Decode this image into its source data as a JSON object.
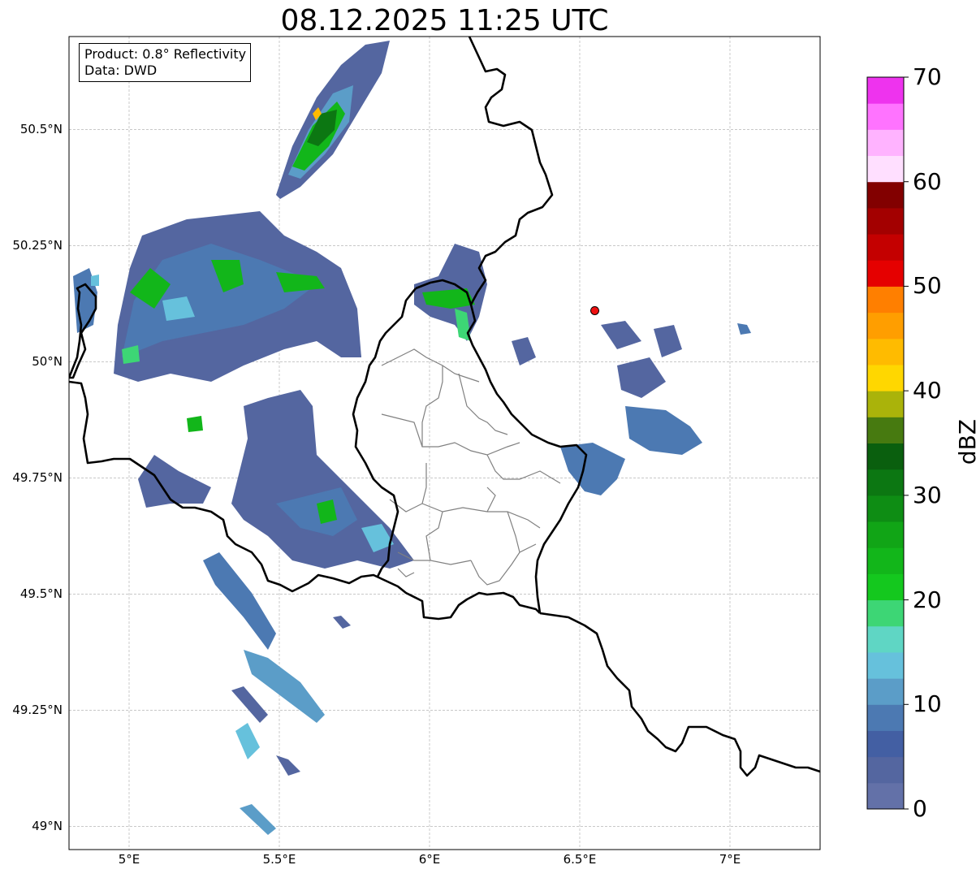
{
  "title": "08.12.2025 11:25 UTC",
  "info_box": {
    "product": "Product: 0.8° Reflectivity",
    "source": "Data: DWD"
  },
  "map": {
    "lon_range": [
      4.8,
      7.3
    ],
    "lat_range": [
      48.95,
      50.7
    ],
    "x_ticks": [
      {
        "lon": 5.0,
        "label": "5°E"
      },
      {
        "lon": 5.5,
        "label": "5.5°E"
      },
      {
        "lon": 6.0,
        "label": "6°E"
      },
      {
        "lon": 6.5,
        "label": "6.5°E"
      },
      {
        "lon": 7.0,
        "label": "7°E"
      }
    ],
    "y_ticks": [
      {
        "lat": 50.5,
        "label": "50.5°N"
      },
      {
        "lat": 50.25,
        "label": "50.25°N"
      },
      {
        "lat": 50.0,
        "label": "50°N"
      },
      {
        "lat": 49.75,
        "label": "49.75°N"
      },
      {
        "lat": 49.5,
        "label": "49.5°N"
      },
      {
        "lat": 49.25,
        "label": "49.25°N"
      },
      {
        "lat": 49.0,
        "label": "49°N"
      }
    ],
    "gridlines": true,
    "radar_site": {
      "lon": 6.55,
      "lat": 50.11,
      "color": "#ee1111"
    }
  },
  "colorbar": {
    "label": "dBZ",
    "range": [
      0,
      70
    ],
    "ticks": [
      {
        "value": 0,
        "label": "0"
      },
      {
        "value": 10,
        "label": "10"
      },
      {
        "value": 20,
        "label": "20"
      },
      {
        "value": 30,
        "label": "30"
      },
      {
        "value": 40,
        "label": "40"
      },
      {
        "value": 50,
        "label": "50"
      },
      {
        "value": 60,
        "label": "60"
      },
      {
        "value": 70,
        "label": "70"
      }
    ],
    "colors": [
      "#6371a8",
      "#5466a0",
      "#435fa3",
      "#4c79b2",
      "#5b9dc8",
      "#66c1dc",
      "#5fd6c4",
      "#3dd675",
      "#14c81e",
      "#12b61a",
      "#11a516",
      "#0e8d14",
      "#0c7712",
      "#0a5f0e",
      "#477a10",
      "#aab30a",
      "#ffd700",
      "#ffbb00",
      "#ff9e00",
      "#ff7f00",
      "#e50000",
      "#c40000",
      "#a30000",
      "#820000",
      "#ffdfff",
      "#ffb3ff",
      "#ff73ff",
      "#ee33ee"
    ]
  }
}
